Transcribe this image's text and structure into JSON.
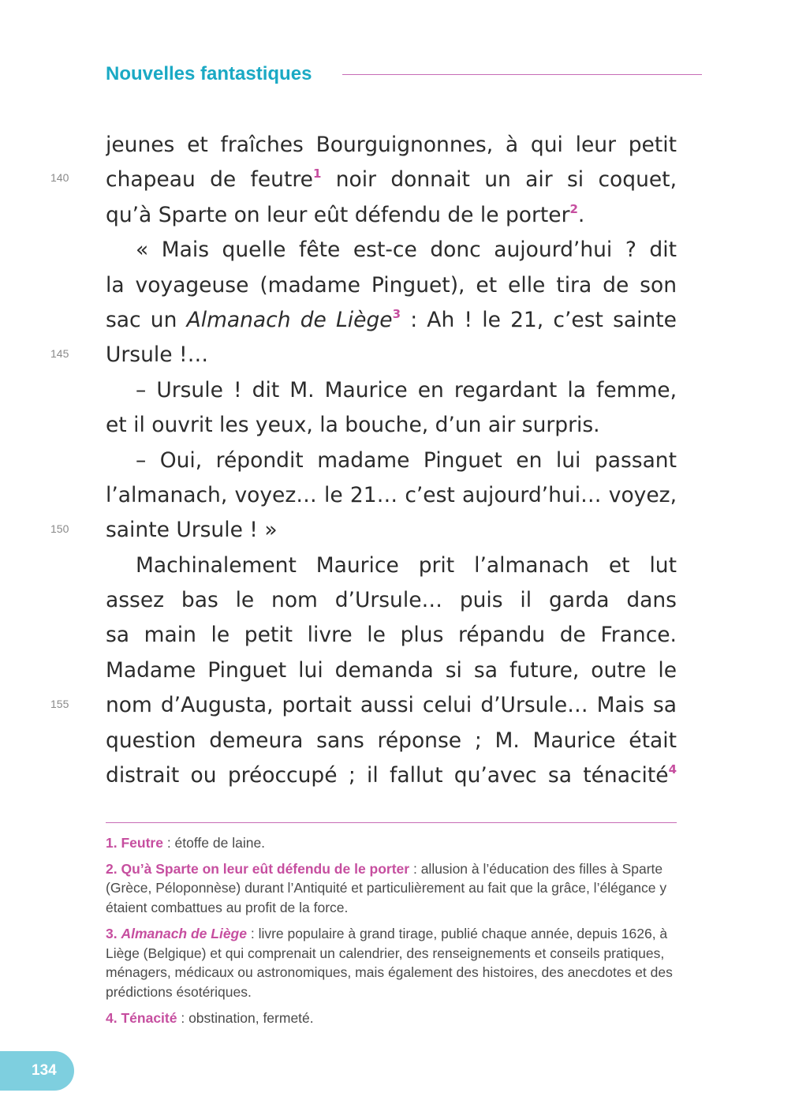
{
  "header": {
    "title": "Nouvelles fantastiques"
  },
  "line_numbers": [
    "140",
    "145",
    "150",
    "155"
  ],
  "lines": {
    "l1": "jeunes et fraîches Bourguignonnes, à qui leur petit",
    "l2a": "chapeau de feutre",
    "l2b": " noir donnait un air si coquet,",
    "l3a": "qu’à Sparte on leur eût défendu de le porter",
    "l3b": ".",
    "l4": "« Mais quelle fête est-ce donc aujourd’hui ? dit",
    "l5": "la voyageuse (madame Pinguet), et elle tira de son",
    "l6a": "sac un ",
    "l6b": "Almanach de Liège",
    "l6c": " : Ah ! le 21, c’est sainte",
    "l7": "Ursule !…",
    "l8": "– Ursule ! dit M. Maurice en regardant la femme,",
    "l9": "et il ouvrit les yeux, la bouche, d’un air surpris.",
    "l10": "– Oui, répondit madame Pinguet en lui passant",
    "l11": "l’almanach, voyez… le 21… c’est aujourd’hui… voyez,",
    "l12": "sainte Ursule ! »",
    "l13": "Machinalement Maurice prit l’almanach et lut",
    "l14": "assez bas le nom d’Ursule… puis il garda dans",
    "l15": "sa main le petit livre le plus répandu de France.",
    "l16": "Madame Pinguet lui demanda si sa future, outre le",
    "l17": "nom d’Augusta, portait aussi celui d’Ursule… Mais sa",
    "l18": "question demeura sans réponse ; M. Maurice était",
    "l19": "distrait ou préoccupé ; il fallut qu’avec sa ténacité"
  },
  "footnote_markers": [
    "1",
    "2",
    "3",
    "4"
  ],
  "footnotes": [
    {
      "num": "1.",
      "term": "Feutre",
      "text": " : étoffe de laine."
    },
    {
      "num": "2.",
      "term": "Qu’à Sparte on leur eût défendu de le porter",
      "text": " : allusion à l’éducation des filles à Sparte (Grèce, Péloponnèse) durant l’Antiquité et particulièrement au fait que la grâce, l’élégance y étaient combattues au profit de la force."
    },
    {
      "num": "3.",
      "term": "Almanach de Liège",
      "text": " : livre populaire à grand tirage, publié chaque année, depuis 1626, à Liège (Belgique) et qui comprenait un calendrier, des renseignements et conseils pratiques, ménagers, médicaux ou astronomiques, mais également des histoires, des anecdotes et des prédictions ésotériques."
    },
    {
      "num": "4.",
      "term": "Ténacité",
      "text": " : obstination, fermeté."
    }
  ],
  "page_number": "134",
  "colors": {
    "accent_teal": "#1aa9c4",
    "accent_magenta": "#c64e9f",
    "tab": "#7ecfdf"
  }
}
